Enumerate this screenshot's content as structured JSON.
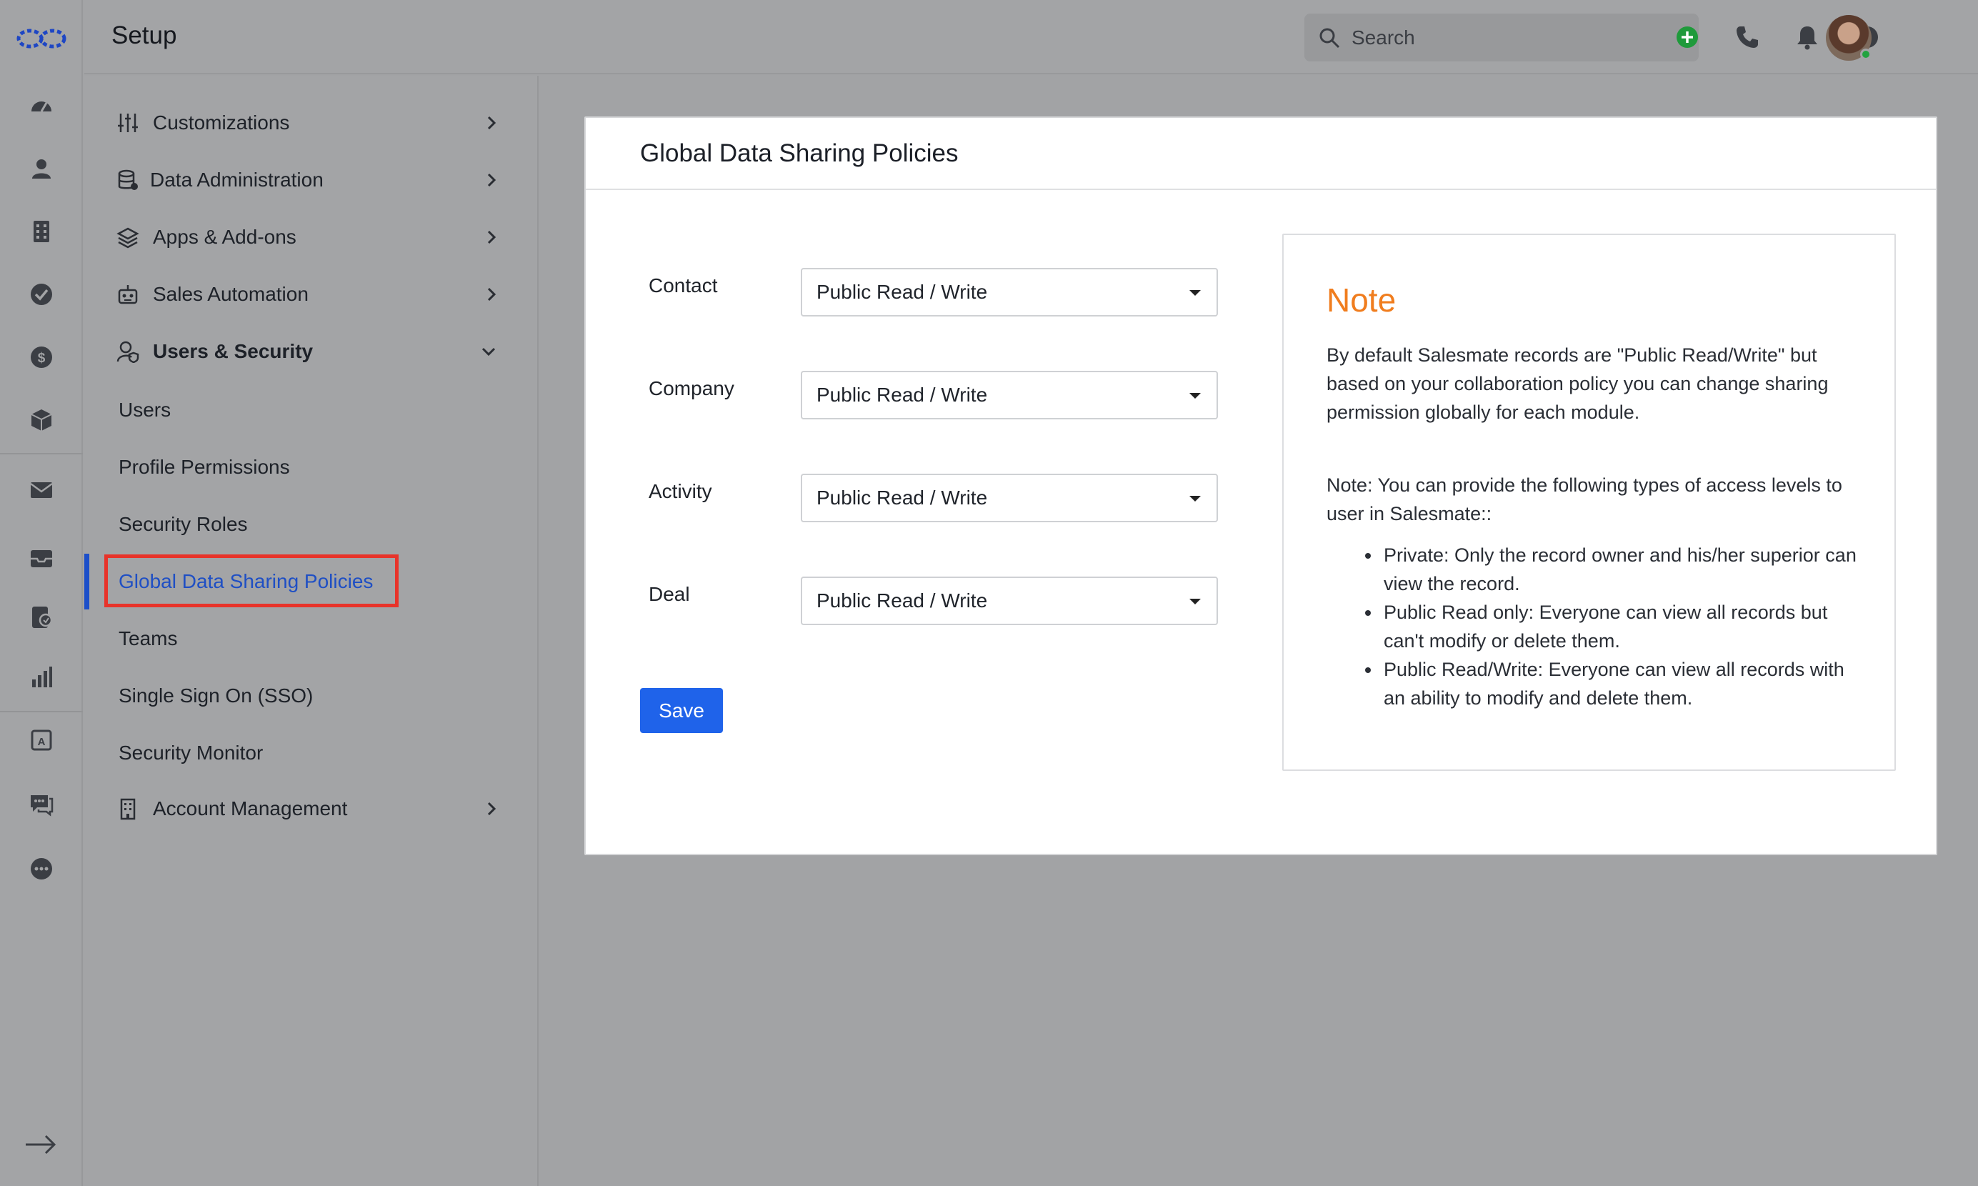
{
  "header": {
    "title": "Setup"
  },
  "search": {
    "placeholder": "Search"
  },
  "setup_nav": {
    "groups": [
      {
        "label": "Customizations"
      },
      {
        "label": "Data Administration"
      },
      {
        "label": "Apps & Add-ons"
      },
      {
        "label": "Sales Automation"
      },
      {
        "label": "Users & Security"
      }
    ],
    "users_security_items": [
      {
        "label": "Users"
      },
      {
        "label": "Profile Permissions"
      },
      {
        "label": "Security Roles"
      },
      {
        "label": "Global Data Sharing Policies"
      },
      {
        "label": "Teams"
      },
      {
        "label": "Single Sign On (SSO)"
      },
      {
        "label": "Security Monitor"
      }
    ],
    "account_management": {
      "label": "Account Management"
    }
  },
  "card": {
    "title": "Global Data Sharing Policies",
    "fields": [
      {
        "label": "Contact",
        "value": "Public Read / Write"
      },
      {
        "label": "Company",
        "value": "Public Read / Write"
      },
      {
        "label": "Activity",
        "value": "Public Read / Write"
      },
      {
        "label": "Deal",
        "value": "Public Read / Write"
      }
    ],
    "save_label": "Save"
  },
  "note": {
    "title": "Note",
    "paragraph1": "By default Salesmate records are \"Public Read/Write\" but based on your collaboration policy you can change sharing permission globally for each module.",
    "paragraph2": "Note: You can provide the following types of access levels to user in Salesmate::",
    "bullets": [
      "Private: Only the record owner and his/her superior can view the record.",
      "Public Read only: Everyone can view all records but can't modify or delete them.",
      "Public Read/Write: Everyone can view all records with an ability to modify and delete them."
    ]
  },
  "colors": {
    "accent": "#1f63ea",
    "active_nav": "#1f4fc4",
    "highlight_border": "#e8332a",
    "note_title": "#f07d1e",
    "online": "#22a33f",
    "add": "#1f9a3b"
  },
  "icons": {
    "rail": [
      "logo-icon",
      "dashboard-icon",
      "contacts-icon",
      "companies-icon",
      "tasks-icon",
      "deals-icon",
      "products-icon",
      "email-icon",
      "inbox-icon",
      "sequences-icon",
      "reports-icon",
      "automation-icon",
      "chat-icon",
      "more-icon",
      "expand-icon"
    ],
    "top": [
      "search-icon",
      "add-icon",
      "phone-icon",
      "bell-icon",
      "help-icon",
      "avatar"
    ]
  }
}
